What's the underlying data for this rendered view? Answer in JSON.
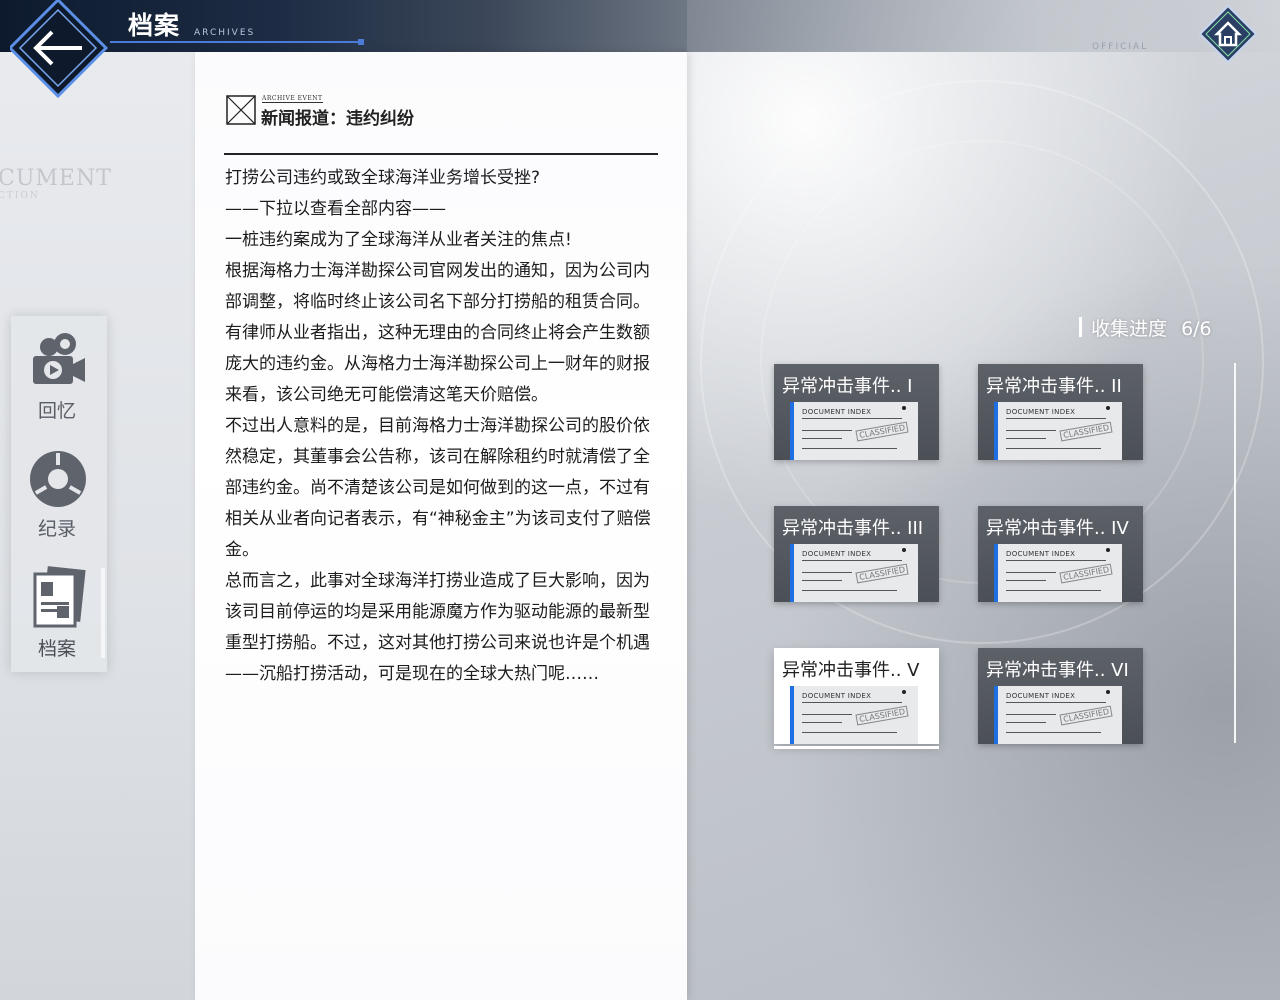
{
  "header": {
    "title": "档案",
    "subtitle": "ARCHIVES",
    "official_text": "OFFICIAL"
  },
  "background": {
    "ghost_text": "CUMENT",
    "ghost_sub": "CTION"
  },
  "sidebar": {
    "items": [
      {
        "label": "回忆",
        "icon": "camera-icon"
      },
      {
        "label": "纪录",
        "icon": "record-icon"
      },
      {
        "label": "档案",
        "icon": "archive-icon",
        "active": true
      }
    ]
  },
  "document": {
    "tag": "ARCHIVE EVENT",
    "title": "新闻报道：违约纠纷",
    "paragraphs": [
      "打捞公司违约或致全球海洋业务增长受挫?",
      "——下拉以查看全部内容——",
      "一桩违约案成为了全球海洋从业者关注的焦点!",
      "根据海格力士海洋勘探公司官网发出的通知，因为公司内部调整，将临时终止该公司名下部分打捞船的租赁合同。有律师从业者指出，这种无理由的合同终止将会产生数额庞大的违约金。从海格力士海洋勘探公司上一财年的财报来看，该公司绝无可能偿清这笔天价赔偿。",
      "不过出人意料的是，目前海格力士海洋勘探公司的股价依然稳定，其董事会公告称，该司在解除租约时就清偿了全部违约金。尚不清楚该公司是如何做到的这一点，不过有相关从业者向记者表示，有“神秘金主”为该司支付了赔偿金。",
      "总而言之，此事对全球海洋打捞业造成了巨大影响，因为该司目前停运的均是采用能源魔方作为驱动能源的最新型重型打捞船。不过，这对其他打捞公司来说也许是个机遇——沉船打捞活动，可是现在的全球大热门呢……"
    ]
  },
  "collection": {
    "label": "收集进度",
    "value": "6/6",
    "cards": [
      {
        "title": "异常冲击事件.. I",
        "paper_header": "DOCUMENT INDEX",
        "stamp": "CLASSIFIED",
        "selected": false
      },
      {
        "title": "异常冲击事件.. II",
        "paper_header": "DOCUMENT INDEX",
        "stamp": "CLASSIFIED",
        "selected": false
      },
      {
        "title": "异常冲击事件.. III",
        "paper_header": "DOCUMENT INDEX",
        "stamp": "CLASSIFIED",
        "selected": false
      },
      {
        "title": "异常冲击事件.. IV",
        "paper_header": "DOCUMENT INDEX",
        "stamp": "CLASSIFIED",
        "selected": false
      },
      {
        "title": "异常冲击事件.. V",
        "paper_header": "DOCUMENT INDEX",
        "stamp": "CLASSIFIED",
        "selected": true
      },
      {
        "title": "异常冲击事件.. VI",
        "paper_header": "DOCUMENT INDEX",
        "stamp": "CLASSIFIED",
        "selected": false
      }
    ]
  },
  "colors": {
    "accent": "#1e6fe3",
    "header_dark": "#0d1a2e",
    "nav_text": "#585d66"
  }
}
